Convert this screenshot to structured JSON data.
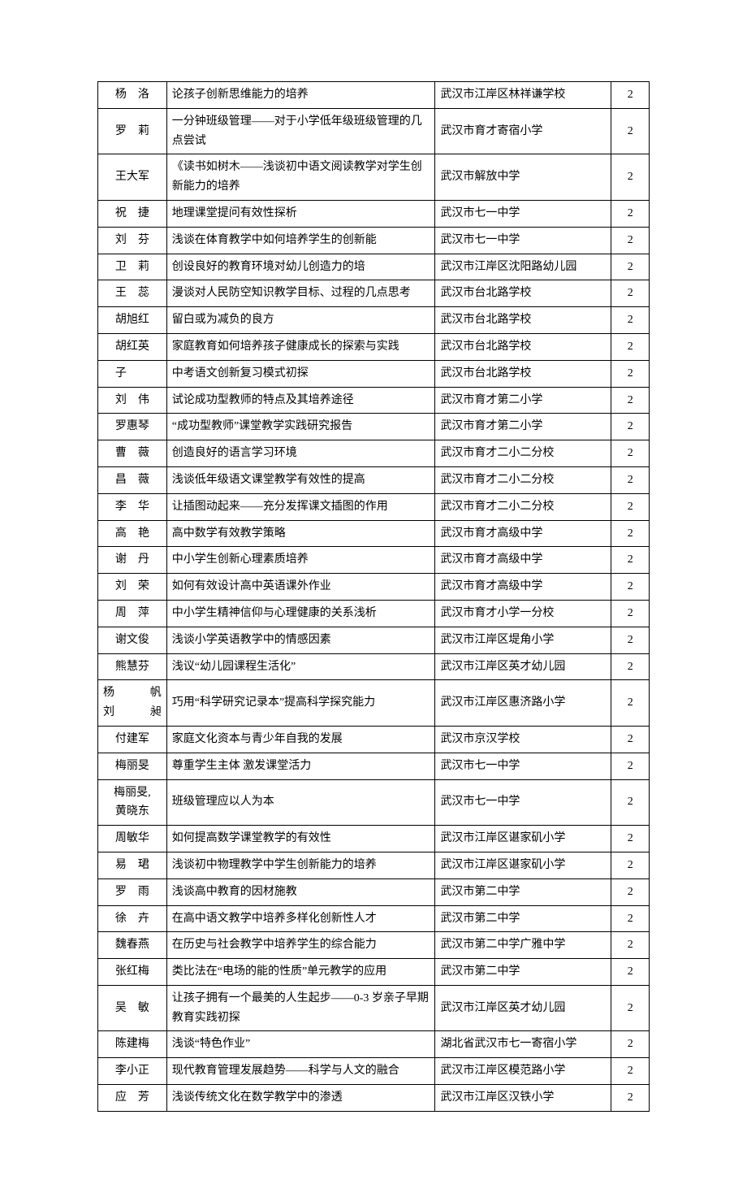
{
  "rows": [
    {
      "authors": [
        "杨 洛"
      ],
      "title": "论孩子创新思维能力的培养",
      "school": "武汉市江岸区林祥谦学校",
      "score": "2"
    },
    {
      "authors": [
        "罗 莉"
      ],
      "title": "一分钟班级管理——对于小学低年级班级管理的几点尝试",
      "school": "武汉市育才寄宿小学",
      "score": "2"
    },
    {
      "authors": [
        "王大军"
      ],
      "title": "《读书如树木——浅谈初中语文阅读教学对学生创新能力的培养",
      "school": "武汉市解放中学",
      "score": "2"
    },
    {
      "authors": [
        "祝 捷"
      ],
      "title": "地理课堂提问有效性探析",
      "school": "武汉市七一中学",
      "score": "2"
    },
    {
      "authors": [
        "刘 芬"
      ],
      "title": "浅谈在体育教学中如何培养学生的创新能",
      "school": "武汉市七一中学",
      "score": "2"
    },
    {
      "authors": [
        "卫 莉"
      ],
      "title": "创设良好的教育环境对幼儿创造力的培",
      "school": "武汉市江岸区沈阳路幼儿园",
      "score": "2"
    },
    {
      "authors": [
        "王 蕊"
      ],
      "title": "漫谈对人民防空知识教学目标、过程的几点思考",
      "school": "武汉市台北路学校",
      "score": "2"
    },
    {
      "authors": [
        "胡旭红"
      ],
      "title": "留白或为减负的良方",
      "school": "武汉市台北路学校",
      "score": "2"
    },
    {
      "authors": [
        "胡红英"
      ],
      "title": "家庭教育如何培养孩子健康成长的探索与实践",
      "school": "武汉市台北路学校",
      "score": "2"
    },
    {
      "authors": [
        "子"
      ],
      "title": "中考语文创新复习模式初探",
      "school": "武汉市台北路学校",
      "score": "2"
    },
    {
      "authors": [
        "刘 伟"
      ],
      "title": "试论成功型教师的特点及其培养途径",
      "school": "武汉市育才第二小学",
      "score": "2"
    },
    {
      "authors": [
        "罗惠琴"
      ],
      "title": "“成功型教师”课堂教学实践研究报告",
      "school": "武汉市育才第二小学",
      "score": "2"
    },
    {
      "authors": [
        "曹 薇"
      ],
      "title": "创造良好的语言学习环境",
      "school": "武汉市育才二小二分校",
      "score": "2"
    },
    {
      "authors": [
        "昌 薇"
      ],
      "title": "浅谈低年级语文课堂教学有效性的提高",
      "school": "武汉市育才二小二分校",
      "score": "2"
    },
    {
      "authors": [
        "李 华"
      ],
      "title": "让插图动起来——充分发挥课文插图的作用",
      "school": "武汉市育才二小二分校",
      "score": "2"
    },
    {
      "authors": [
        "高 艳"
      ],
      "title": "高中数学有效教学策略",
      "school": "武汉市育才高级中学",
      "score": "2"
    },
    {
      "authors": [
        "谢 丹"
      ],
      "title": "中小学生创新心理素质培养",
      "school": "武汉市育才高级中学",
      "score": "2"
    },
    {
      "authors": [
        "刘 荣"
      ],
      "title": "如何有效设计高中英语课外作业",
      "school": "武汉市育才高级中学",
      "score": "2"
    },
    {
      "authors": [
        "周 萍"
      ],
      "title": "中小学生精神信仰与心理健康的关系浅析",
      "school": "武汉市育才小学一分校",
      "score": "2"
    },
    {
      "authors": [
        "谢文俊"
      ],
      "title": "浅谈小学英语教学中的情感因素",
      "school": "武汉市江岸区堤角小学",
      "score": "2"
    },
    {
      "authors": [
        "熊慧芬"
      ],
      "title": "浅议“幼儿园课程生活化”",
      "school": "武汉市江岸区英才幼儿园",
      "score": "2"
    },
    {
      "authors": [
        "杨 帆",
        "刘 昶"
      ],
      "title": "巧用“科学研究记录本”提高科学探究能力",
      "school": "武汉市江岸区惠济路小学",
      "score": "2"
    },
    {
      "authors": [
        "付建军"
      ],
      "title": "家庭文化资本与青少年自我的发展",
      "school": "武汉市京汉学校",
      "score": "2"
    },
    {
      "authors": [
        "梅丽旻"
      ],
      "title": "尊重学生主体 激发课堂活力",
      "school": "武汉市七一中学",
      "score": "2"
    },
    {
      "authors": [
        "梅丽旻,",
        "黄晓东"
      ],
      "title": "班级管理应以人为本",
      "school": "武汉市七一中学",
      "score": "2"
    },
    {
      "authors": [
        "周敏华"
      ],
      "title": "如何提高数学课堂教学的有效性",
      "school": "武汉市江岸区谌家矶小学",
      "score": "2"
    },
    {
      "authors": [
        "易 珺"
      ],
      "title": "浅谈初中物理教学中学生创新能力的培养",
      "school": "武汉市江岸区谌家矶小学",
      "score": "2"
    },
    {
      "authors": [
        "罗 雨"
      ],
      "title": "浅谈高中教育的因材施教",
      "school": "武汉市第二中学",
      "score": "2"
    },
    {
      "authors": [
        "徐 卉"
      ],
      "title": "在高中语文教学中培养多样化创新性人才",
      "school": "武汉市第二中学",
      "score": "2"
    },
    {
      "authors": [
        "魏春燕"
      ],
      "title": "在历史与社会教学中培养学生的综合能力",
      "school": "武汉市第二中学广雅中学",
      "score": "2"
    },
    {
      "authors": [
        "张红梅"
      ],
      "title": "类比法在“电场的能的性质”单元教学的应用",
      "school": "武汉市第二中学",
      "score": "2"
    },
    {
      "authors": [
        "吴 敏"
      ],
      "title": "让孩子拥有一个最美的人生起步——0-3 岁亲子早期教育实践初探",
      "school": "武汉市江岸区英才幼儿园",
      "score": "2"
    },
    {
      "authors": [
        "陈建梅"
      ],
      "title": "浅谈“特色作业”",
      "school": "湖北省武汉市七一寄宿小学",
      "score": "2"
    },
    {
      "authors": [
        "李小正"
      ],
      "title": "现代教育管理发展趋势——科学与人文的融合",
      "school": "武汉市江岸区模范路小学",
      "score": "2"
    },
    {
      "authors": [
        "应 芳"
      ],
      "title": "浅谈传统文化在数学教学中的渗透",
      "school": "武汉市江岸区汉铁小学",
      "score": "2"
    }
  ]
}
